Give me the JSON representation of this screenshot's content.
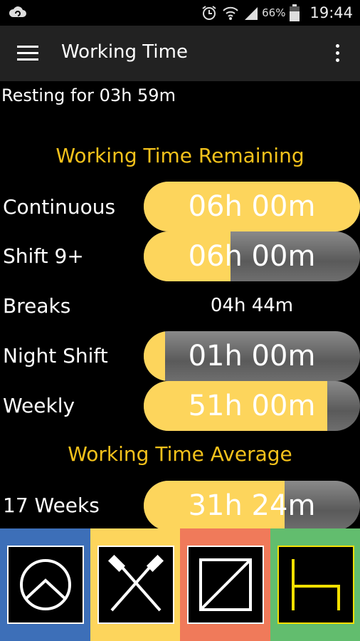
{
  "status": {
    "battery": "66%",
    "time": "19:44"
  },
  "appbar": {
    "title": "Working Time"
  },
  "resting": "Resting for 03h 59m",
  "remaining": {
    "title": "Working Time Remaining",
    "rows": [
      {
        "label": "Continuous",
        "value": "06h 00m",
        "fill": 1.0
      },
      {
        "label": "Shift 9+",
        "value": "06h 00m",
        "fill": 0.4
      },
      {
        "label": "Breaks",
        "value": "04h 44m"
      },
      {
        "label": "Night Shift",
        "value": "01h 00m",
        "fill": 0.1
      },
      {
        "label": "Weekly",
        "value": "51h 00m",
        "fill": 0.85
      }
    ]
  },
  "average": {
    "title": "Working Time Average",
    "rows": [
      {
        "label": "17 Weeks",
        "value": "31h 24m",
        "fill": 0.65
      }
    ]
  },
  "tabs": [
    {
      "icon": "clock-chevron-icon",
      "color": "#3d6fb8"
    },
    {
      "icon": "crossed-hammers-icon",
      "color": "#fdd55c"
    },
    {
      "icon": "diagonal-square-icon",
      "color": "#f07a5a"
    },
    {
      "icon": "bed-icon",
      "color": "#62bd6e"
    }
  ]
}
